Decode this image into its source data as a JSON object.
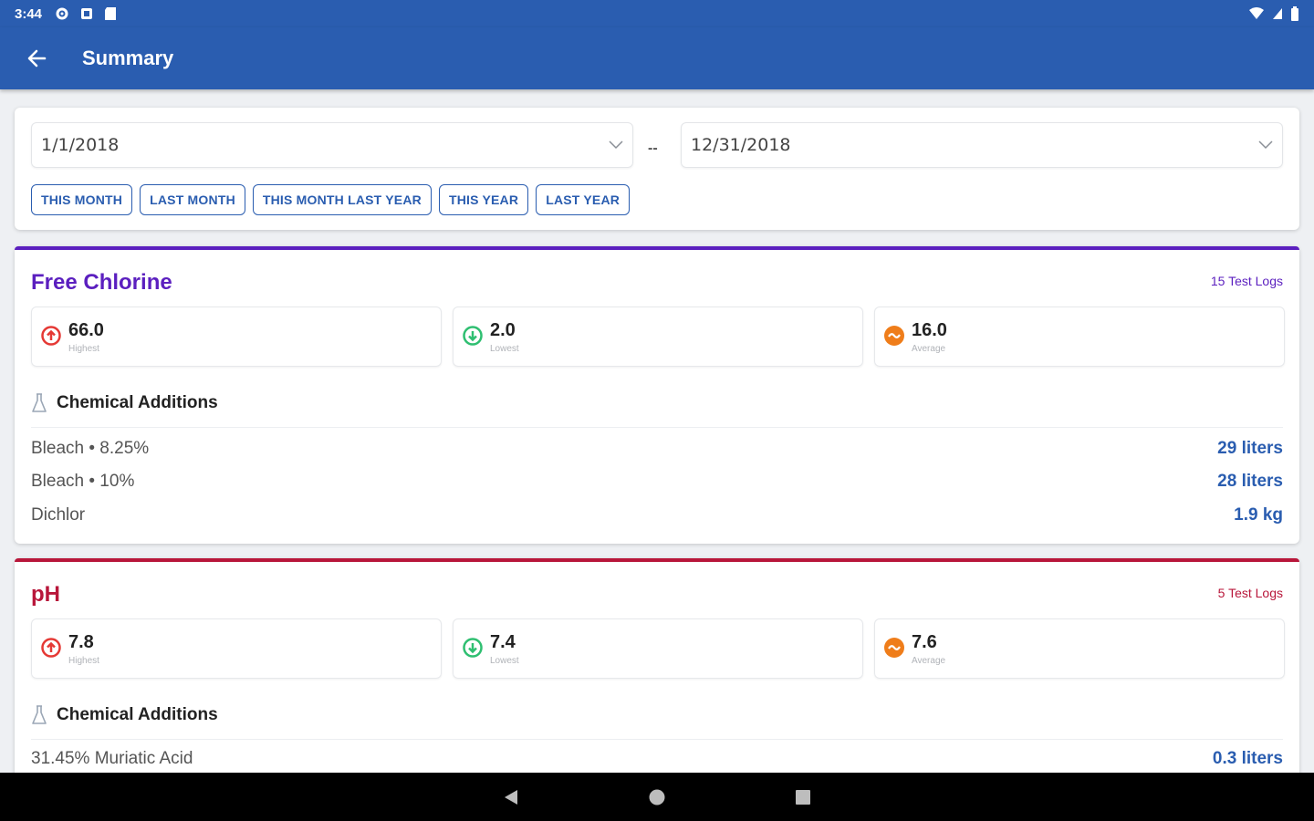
{
  "status_bar": {
    "time": "3:44"
  },
  "app_bar": {
    "title": "Summary"
  },
  "date_range": {
    "start": "1/1/2018",
    "end": "12/31/2018",
    "separator": "--",
    "quick_ranges": [
      "THIS MONTH",
      "LAST MONTH",
      "THIS MONTH LAST YEAR",
      "THIS YEAR",
      "LAST YEAR"
    ]
  },
  "parameters": [
    {
      "name": "Free Chlorine",
      "color": "#5b1fbf",
      "test_logs": "15 Test Logs",
      "stats": [
        {
          "value": "66.0",
          "label": "Highest",
          "kind": "highest"
        },
        {
          "value": "2.0",
          "label": "Lowest",
          "kind": "lowest"
        },
        {
          "value": "16.0",
          "label": "Average",
          "kind": "average"
        }
      ],
      "chem_title": "Chemical Additions",
      "chemicals": [
        {
          "name": "Bleach • 8.25%",
          "amount": "29 liters"
        },
        {
          "name": "Bleach • 10%",
          "amount": "28 liters"
        },
        {
          "name": "Dichlor",
          "amount": "1.9 kg"
        }
      ]
    },
    {
      "name": "pH",
      "color": "#b8163a",
      "test_logs": "5 Test Logs",
      "stats": [
        {
          "value": "7.8",
          "label": "Highest",
          "kind": "highest"
        },
        {
          "value": "7.4",
          "label": "Lowest",
          "kind": "lowest"
        },
        {
          "value": "7.6",
          "label": "Average",
          "kind": "average"
        }
      ],
      "chem_title": "Chemical Additions",
      "chemicals": [
        {
          "name": "31.45% Muriatic Acid",
          "amount": "0.3 liters"
        }
      ]
    }
  ],
  "colors": {
    "primary": "#2a5db0",
    "highest": "#e53935",
    "lowest": "#2fbf71",
    "average": "#ef7d1a"
  }
}
